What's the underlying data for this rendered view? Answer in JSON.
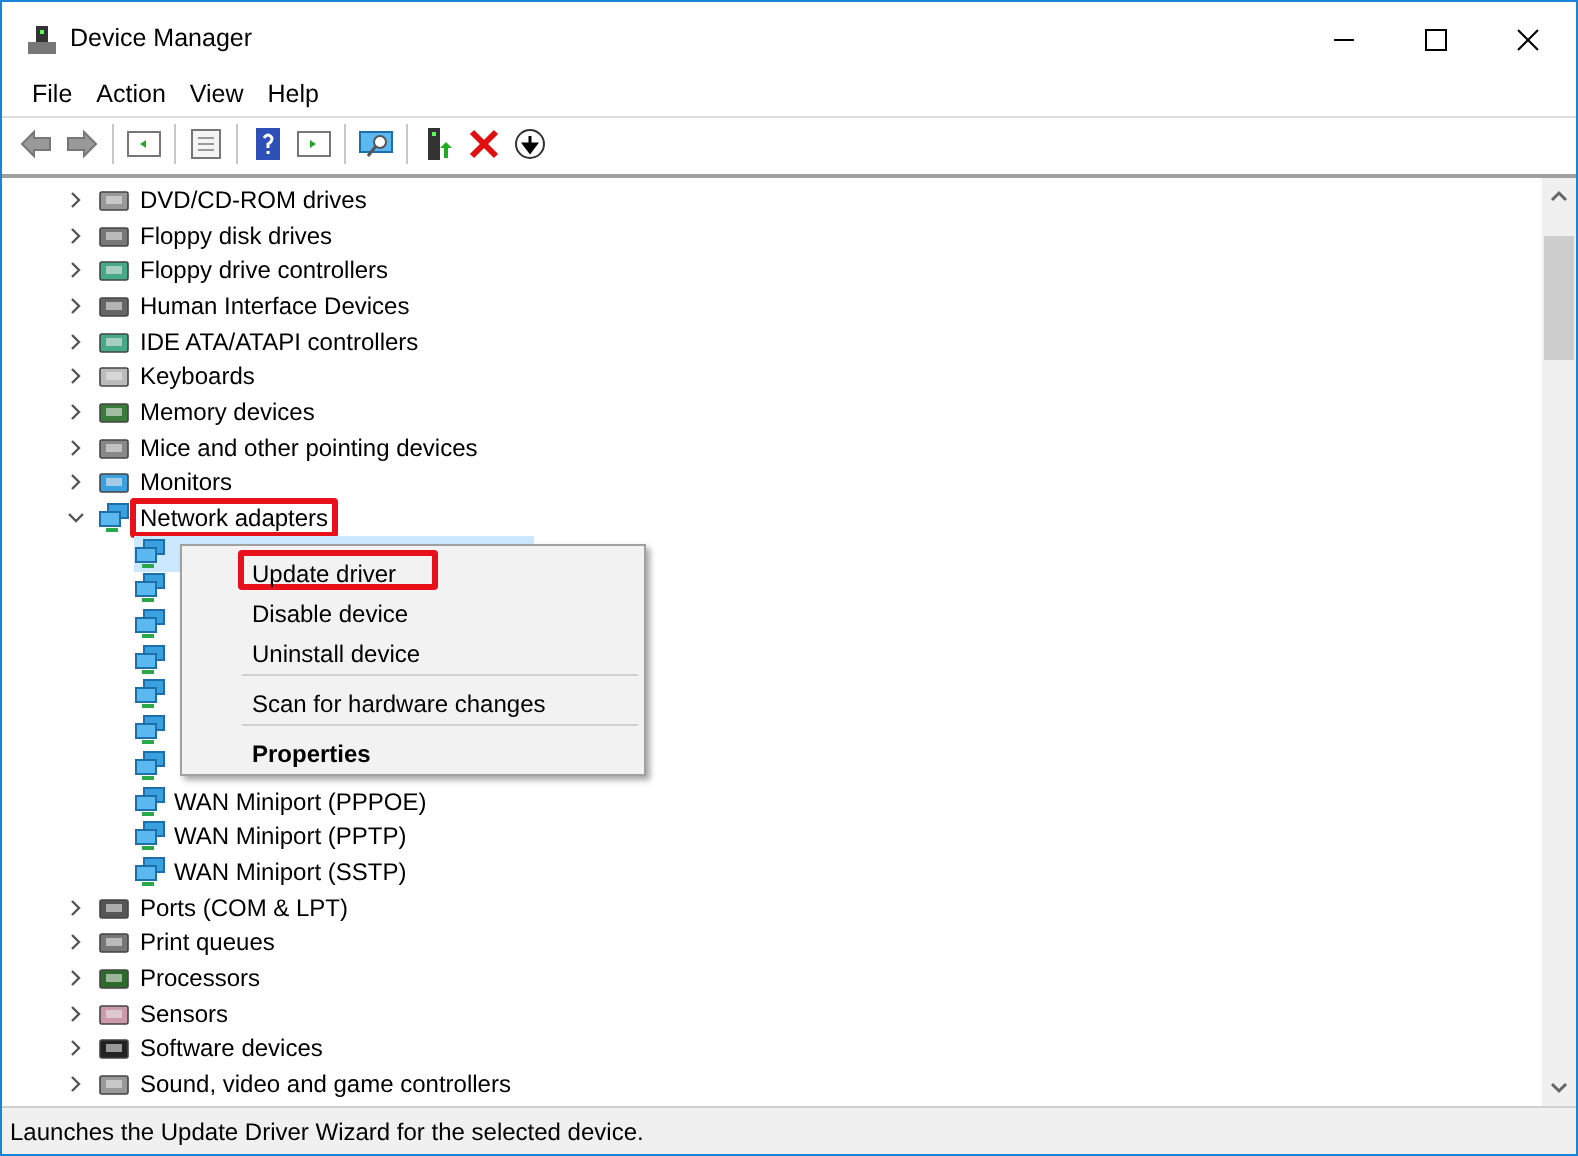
{
  "window": {
    "title": "Device Manager"
  },
  "menu_bar": [
    "File",
    "Action",
    "View",
    "Help"
  ],
  "tree": [
    {
      "label": "DVD/CD-ROM drives",
      "expanded": false,
      "highlighted": false
    },
    {
      "label": "Floppy disk drives",
      "expanded": false,
      "highlighted": false
    },
    {
      "label": "Floppy drive controllers",
      "expanded": false,
      "highlighted": false
    },
    {
      "label": "Human Interface Devices",
      "expanded": false,
      "highlighted": false
    },
    {
      "label": "IDE ATA/ATAPI controllers",
      "expanded": false,
      "highlighted": false
    },
    {
      "label": "Keyboards",
      "expanded": false,
      "highlighted": false
    },
    {
      "label": "Memory devices",
      "expanded": false,
      "highlighted": false
    },
    {
      "label": "Mice and other pointing devices",
      "expanded": false,
      "highlighted": false
    },
    {
      "label": "Monitors",
      "expanded": false,
      "highlighted": false
    },
    {
      "label": "Network adapters",
      "expanded": true,
      "highlighted": true,
      "children": [
        {
          "kind": "covered",
          "selected": true
        },
        {
          "kind": "covered",
          "selected": false
        },
        {
          "kind": "covered",
          "selected": false
        },
        {
          "kind": "covered",
          "selected": false
        },
        {
          "kind": "covered",
          "selected": false
        },
        {
          "kind": "covered",
          "selected": false
        },
        {
          "kind": "covered",
          "selected": false
        },
        {
          "kind": "device",
          "label": "WAN Miniport (PPPOE)",
          "selected": false
        },
        {
          "kind": "device",
          "label": "WAN Miniport (PPTP)",
          "selected": false
        },
        {
          "kind": "device",
          "label": "WAN Miniport (SSTP)",
          "selected": false
        }
      ]
    },
    {
      "label": "Ports (COM & LPT)",
      "expanded": false,
      "highlighted": false
    },
    {
      "label": "Print queues",
      "expanded": false,
      "highlighted": false
    },
    {
      "label": "Processors",
      "expanded": false,
      "highlighted": false
    },
    {
      "label": "Sensors",
      "expanded": false,
      "highlighted": false
    },
    {
      "label": "Software devices",
      "expanded": false,
      "highlighted": false
    },
    {
      "label": "Sound, video and game controllers",
      "expanded": false,
      "highlighted": false
    }
  ],
  "context_menu": [
    {
      "kind": "item",
      "label": "Update driver",
      "bold": false,
      "highlighted": true
    },
    {
      "kind": "item",
      "label": "Disable device",
      "bold": false,
      "highlighted": false
    },
    {
      "kind": "item",
      "label": "Uninstall device",
      "bold": false,
      "highlighted": false
    },
    {
      "kind": "separator"
    },
    {
      "kind": "item",
      "label": "Scan for hardware changes",
      "bold": false,
      "highlighted": false
    },
    {
      "kind": "separator"
    },
    {
      "kind": "item",
      "label": "Properties",
      "bold": true,
      "highlighted": false
    }
  ],
  "status_bar": "Launches the Update Driver Wizard for the selected device."
}
